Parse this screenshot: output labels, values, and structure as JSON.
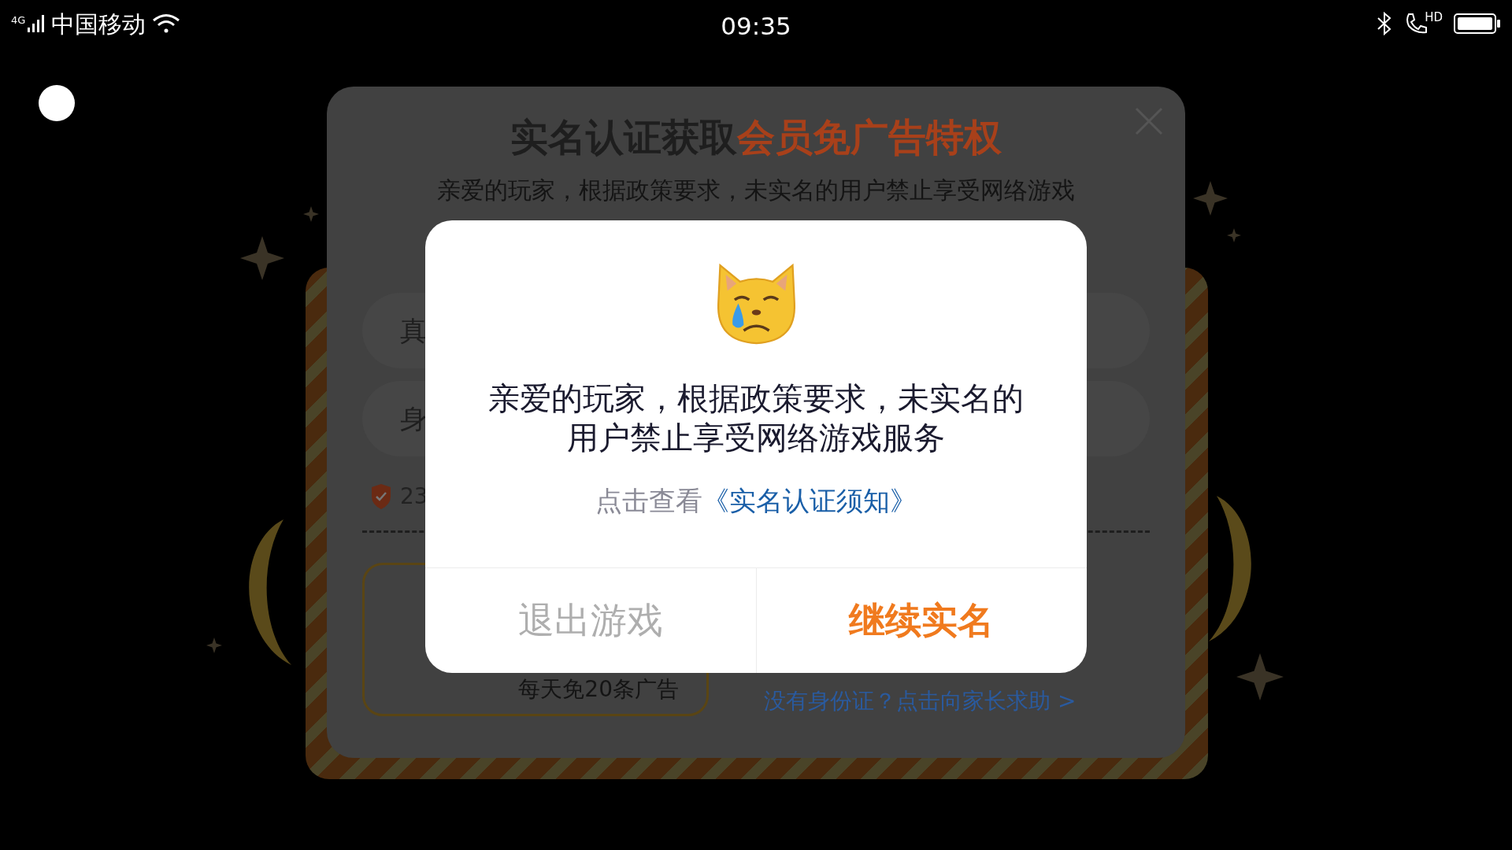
{
  "status_bar": {
    "network": "4G",
    "carrier": "中国移动",
    "time": "09:35",
    "call_badge": "HD"
  },
  "background_card": {
    "title": "实名认证获取",
    "title_highlight": "会员免广告特权",
    "subtitle": "亲爱的玩家，根据政策要求，未实名的用户禁止享受网络游戏",
    "fields": [
      "真",
      "身"
    ],
    "notice": "23",
    "perk": "每天免20条广告",
    "help_link": "没有身份证？点击向家长求助 >"
  },
  "dialog": {
    "message": "亲爱的玩家，根据政策要求，未实名的用户禁止享受网络游戏服务",
    "link_prefix": "点击查看",
    "link": "《实名认证须知》",
    "buttons": [
      {
        "label": "退出游戏",
        "kind": "secondary"
      },
      {
        "label": "继续实名",
        "kind": "primary"
      }
    ]
  }
}
